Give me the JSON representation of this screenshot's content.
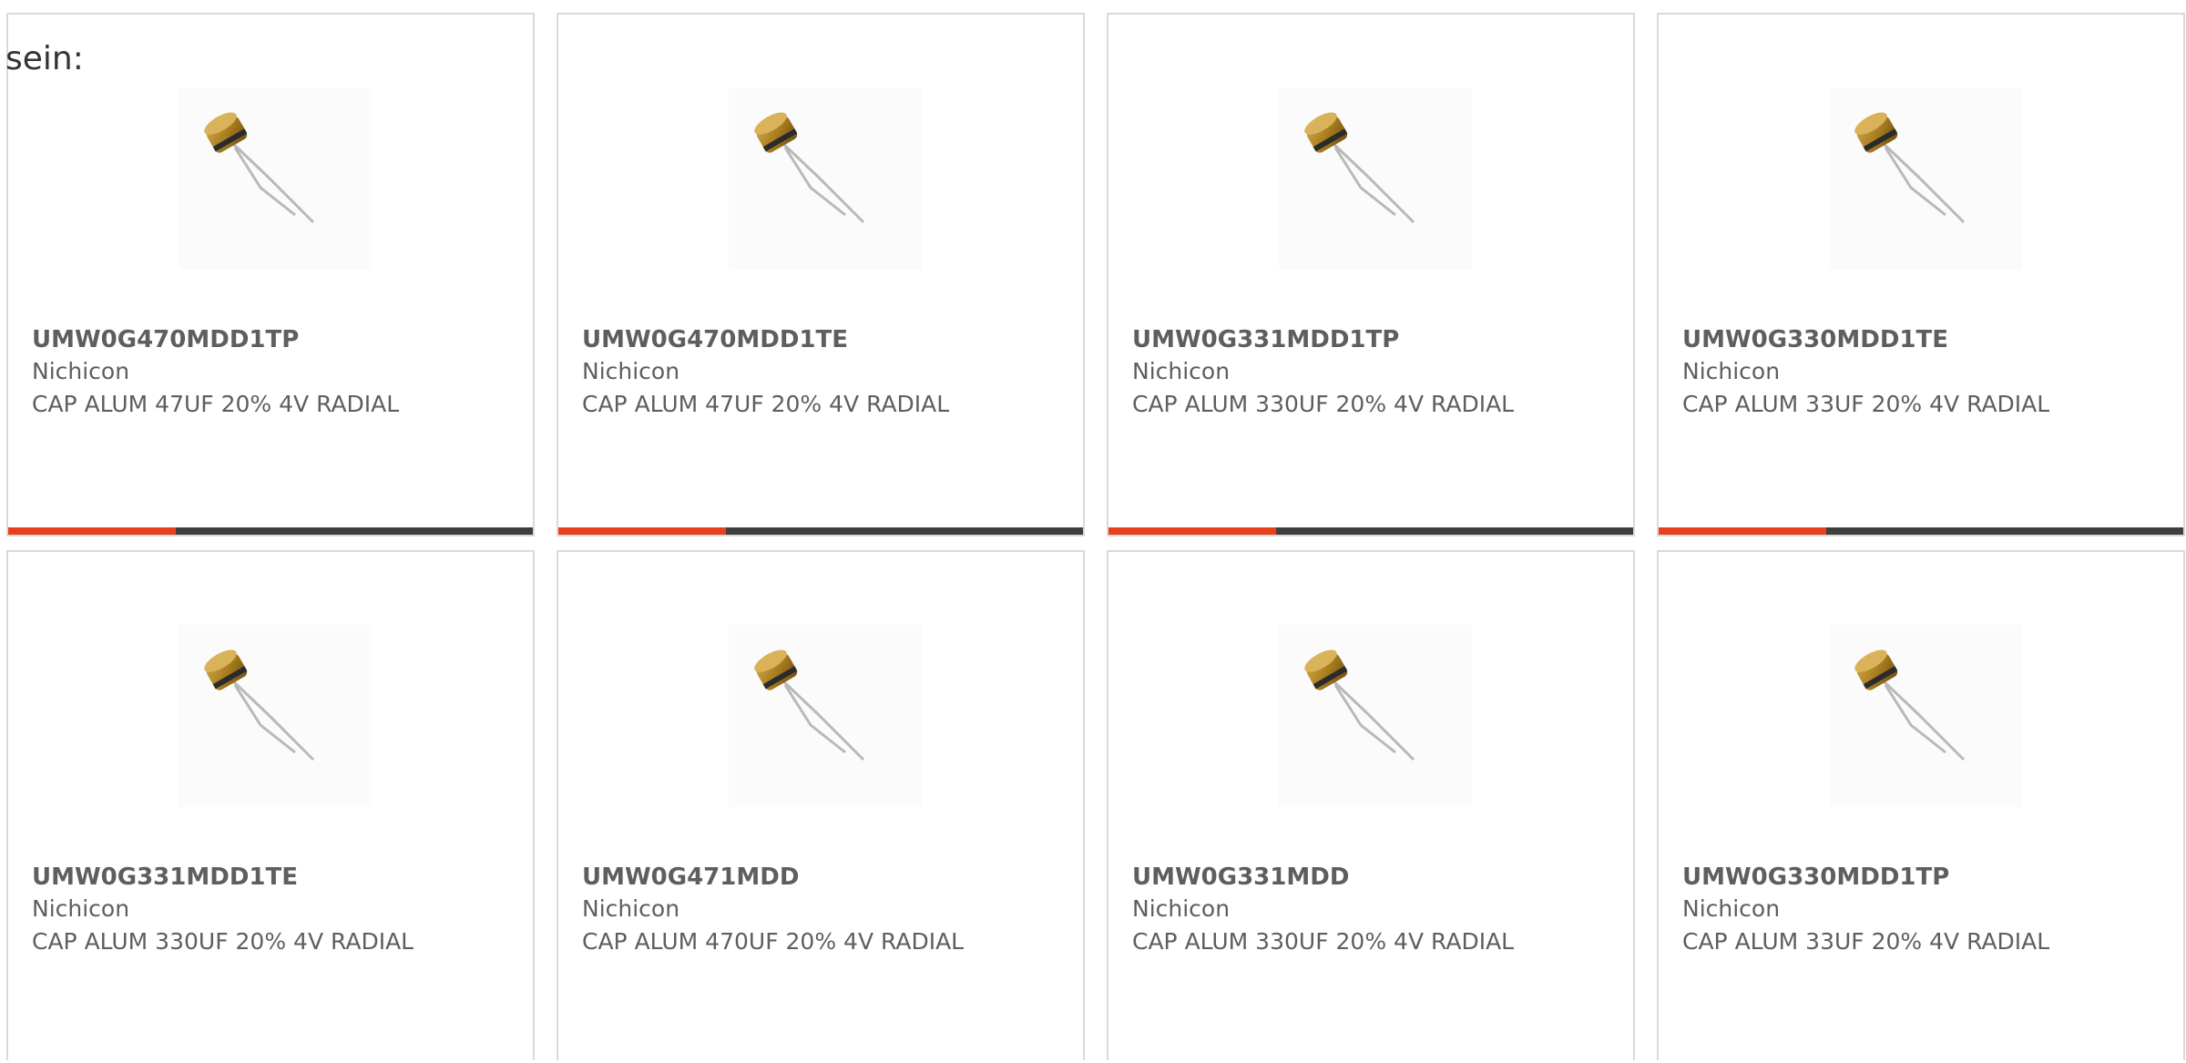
{
  "lead_text": "sein:",
  "accent_color": "#e8401c",
  "bar_color": "#3f3f3f",
  "products": [
    {
      "part_number": "UMW0G470MDD1TP",
      "manufacturer": "Nichicon",
      "description": "CAP ALUM 47UF 20% 4V RADIAL",
      "image_icon": "capacitor-image"
    },
    {
      "part_number": "UMW0G470MDD1TE",
      "manufacturer": "Nichicon",
      "description": "CAP ALUM 47UF 20% 4V RADIAL",
      "image_icon": "capacitor-image"
    },
    {
      "part_number": "UMW0G331MDD1TP",
      "manufacturer": "Nichicon",
      "description": "CAP ALUM 330UF 20% 4V RADIAL",
      "image_icon": "capacitor-image"
    },
    {
      "part_number": "UMW0G330MDD1TE",
      "manufacturer": "Nichicon",
      "description": "CAP ALUM 33UF 20% 4V RADIAL",
      "image_icon": "capacitor-image"
    },
    {
      "part_number": "UMW0G331MDD1TE",
      "manufacturer": "Nichicon",
      "description": "CAP ALUM 330UF 20% 4V RADIAL",
      "image_icon": "capacitor-image"
    },
    {
      "part_number": "UMW0G471MDD",
      "manufacturer": "Nichicon",
      "description": "CAP ALUM 470UF 20% 4V RADIAL",
      "image_icon": "capacitor-image"
    },
    {
      "part_number": "UMW0G331MDD",
      "manufacturer": "Nichicon",
      "description": "CAP ALUM 330UF 20% 4V RADIAL",
      "image_icon": "capacitor-image"
    },
    {
      "part_number": "UMW0G330MDD1TP",
      "manufacturer": "Nichicon",
      "description": "CAP ALUM 33UF 20% 4V RADIAL",
      "image_icon": "capacitor-image"
    }
  ]
}
